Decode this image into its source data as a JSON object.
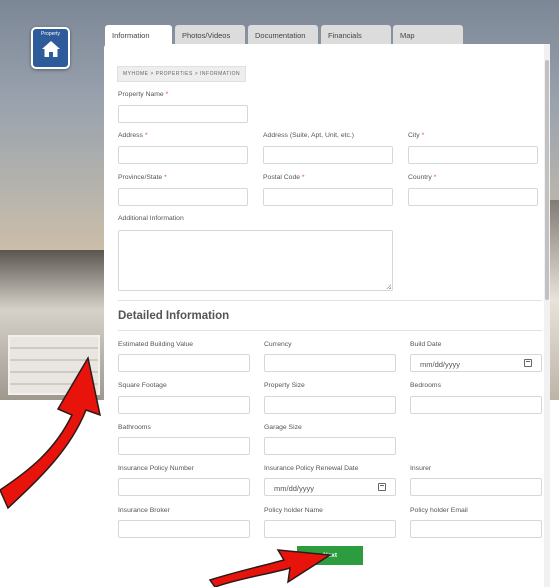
{
  "logo": {
    "label": "Property",
    "icon": "home-icon"
  },
  "tabs": [
    {
      "label": "Information",
      "active": true
    },
    {
      "label": "Photos/Videos"
    },
    {
      "label": "Documentation"
    },
    {
      "label": "Financials"
    },
    {
      "label": "Map"
    }
  ],
  "breadcrumb": "MYHOME > PROPERTIES > INFORMATION",
  "property": {
    "name_label": "Property Name",
    "address_label": "Address",
    "address2_label": "Address (Suite, Apt, Unit, etc.)",
    "city_label": "City",
    "province_label": "Province/State",
    "postal_label": "Postal Code",
    "country_label": "Country",
    "additional_label": "Additional Information",
    "required_mark": "*"
  },
  "detailed": {
    "title": "Detailed Information",
    "estimated_value_label": "Estimated Building Value",
    "currency_label": "Currency",
    "build_date_label": "Build Date",
    "build_date_placeholder": "mm/dd/yyyy",
    "square_footage_label": "Square Footage",
    "property_size_label": "Property Size",
    "bedrooms_label": "Bedrooms",
    "bathrooms_label": "Bathrooms",
    "garage_size_label": "Garage Size",
    "policy_number_label": "Insurance Policy Number",
    "renewal_date_label": "Insurance Policy Renewal Date",
    "renewal_date_placeholder": "mm/dd/yyyy",
    "insurer_label": "Insurer",
    "broker_label": "Insurance Broker",
    "holder_name_label": "Policy holder Name",
    "holder_email_label": "Policy holder Email"
  },
  "next_label": "Next",
  "colors": {
    "accent": "#2d9c3f",
    "logo": "#2e5b9a",
    "required": "#e0483a",
    "arrow": "#e8140c"
  }
}
